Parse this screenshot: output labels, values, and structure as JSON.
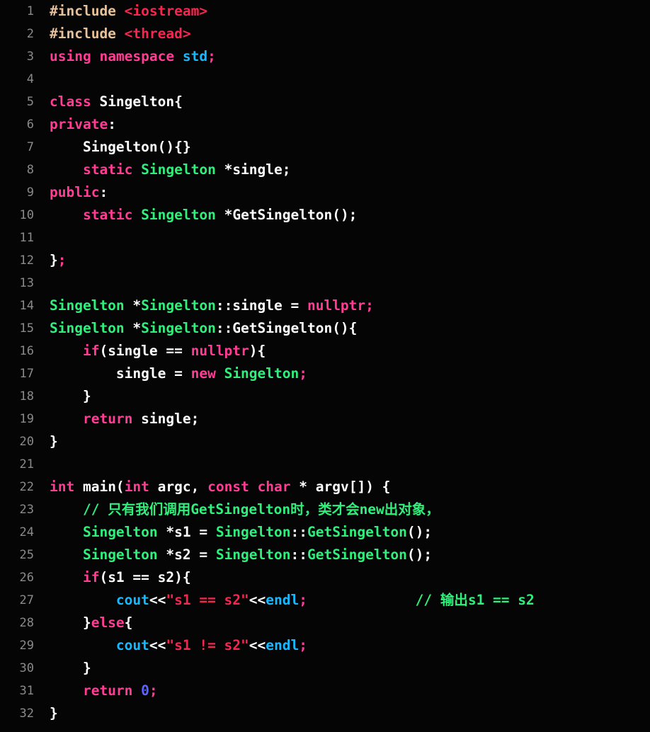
{
  "editor": {
    "language": "cpp",
    "background_color": "#050505",
    "gutter_color": "#8a8a8a",
    "total_lines": 32,
    "colors": {
      "keyword": "#ff3d94",
      "type": "#2ff07a",
      "comment": "#2ff07a",
      "string": "#f5274e",
      "preprocessor": "#e8c09a",
      "header": "#f5274e",
      "builtin": "#18b8ff",
      "number": "#5c63ff",
      "plain": "#ffffff"
    },
    "lines": [
      {
        "number": "1",
        "tokens": [
          {
            "t": "#include",
            "c": "pre"
          },
          {
            "t": " ",
            "c": "plain"
          },
          {
            "t": "<iostream>",
            "c": "header"
          }
        ]
      },
      {
        "number": "2",
        "tokens": [
          {
            "t": "#include",
            "c": "pre"
          },
          {
            "t": " ",
            "c": "plain"
          },
          {
            "t": "<thread>",
            "c": "header"
          }
        ]
      },
      {
        "number": "3",
        "tokens": [
          {
            "t": "using",
            "c": "kw"
          },
          {
            "t": " ",
            "c": "plain"
          },
          {
            "t": "namespace",
            "c": "kw"
          },
          {
            "t": " ",
            "c": "plain"
          },
          {
            "t": "std",
            "c": "builtin"
          },
          {
            "t": ";",
            "c": "semi"
          }
        ]
      },
      {
        "number": "4",
        "tokens": []
      },
      {
        "number": "5",
        "tokens": [
          {
            "t": "class",
            "c": "kw"
          },
          {
            "t": " ",
            "c": "plain"
          },
          {
            "t": "Singelton{",
            "c": "plain"
          }
        ]
      },
      {
        "number": "6",
        "tokens": [
          {
            "t": "private",
            "c": "kw"
          },
          {
            "t": ":",
            "c": "plain"
          }
        ]
      },
      {
        "number": "7",
        "tokens": [
          {
            "t": "    Singelton(){}",
            "c": "plain"
          }
        ]
      },
      {
        "number": "8",
        "tokens": [
          {
            "t": "    ",
            "c": "plain"
          },
          {
            "t": "static",
            "c": "kw"
          },
          {
            "t": " ",
            "c": "plain"
          },
          {
            "t": "Singelton",
            "c": "type"
          },
          {
            "t": " *single;",
            "c": "plain"
          }
        ]
      },
      {
        "number": "9",
        "tokens": [
          {
            "t": "public",
            "c": "kw"
          },
          {
            "t": ":",
            "c": "plain"
          }
        ]
      },
      {
        "number": "10",
        "tokens": [
          {
            "t": "    ",
            "c": "plain"
          },
          {
            "t": "static",
            "c": "kw"
          },
          {
            "t": " ",
            "c": "plain"
          },
          {
            "t": "Singelton",
            "c": "type"
          },
          {
            "t": " *GetSingelton();",
            "c": "plain"
          }
        ]
      },
      {
        "number": "11",
        "tokens": []
      },
      {
        "number": "12",
        "tokens": [
          {
            "t": "}",
            "c": "plain"
          },
          {
            "t": ";",
            "c": "semi"
          }
        ]
      },
      {
        "number": "13",
        "tokens": []
      },
      {
        "number": "14",
        "tokens": [
          {
            "t": "Singelton",
            "c": "type"
          },
          {
            "t": " *",
            "c": "plain"
          },
          {
            "t": "Singelton",
            "c": "type"
          },
          {
            "t": "::single = ",
            "c": "plain"
          },
          {
            "t": "nullptr",
            "c": "kw"
          },
          {
            "t": ";",
            "c": "semi"
          }
        ]
      },
      {
        "number": "15",
        "tokens": [
          {
            "t": "Singelton",
            "c": "type"
          },
          {
            "t": " *",
            "c": "plain"
          },
          {
            "t": "Singelton",
            "c": "type"
          },
          {
            "t": "::GetSingelton(){",
            "c": "plain"
          }
        ]
      },
      {
        "number": "16",
        "tokens": [
          {
            "t": "    ",
            "c": "plain"
          },
          {
            "t": "if",
            "c": "kw"
          },
          {
            "t": "(single == ",
            "c": "plain"
          },
          {
            "t": "nullptr",
            "c": "kw"
          },
          {
            "t": "){",
            "c": "plain"
          }
        ]
      },
      {
        "number": "17",
        "tokens": [
          {
            "t": "        single = ",
            "c": "plain"
          },
          {
            "t": "new",
            "c": "kw"
          },
          {
            "t": " ",
            "c": "plain"
          },
          {
            "t": "Singelton",
            "c": "type"
          },
          {
            "t": ";",
            "c": "semi"
          }
        ]
      },
      {
        "number": "18",
        "tokens": [
          {
            "t": "    }",
            "c": "plain"
          }
        ]
      },
      {
        "number": "19",
        "tokens": [
          {
            "t": "    ",
            "c": "plain"
          },
          {
            "t": "return",
            "c": "kw"
          },
          {
            "t": " single;",
            "c": "plain"
          }
        ]
      },
      {
        "number": "20",
        "tokens": [
          {
            "t": "}",
            "c": "plain"
          }
        ]
      },
      {
        "number": "21",
        "tokens": []
      },
      {
        "number": "22",
        "tokens": [
          {
            "t": "int",
            "c": "kw"
          },
          {
            "t": " main(",
            "c": "plain"
          },
          {
            "t": "int",
            "c": "kw"
          },
          {
            "t": " argc, ",
            "c": "plain"
          },
          {
            "t": "const",
            "c": "kw"
          },
          {
            "t": " ",
            "c": "plain"
          },
          {
            "t": "char",
            "c": "kw"
          },
          {
            "t": " * argv[]) {",
            "c": "plain"
          }
        ]
      },
      {
        "number": "23",
        "tokens": [
          {
            "t": "    ",
            "c": "plain"
          },
          {
            "t": "// 只有我们调用GetSingelton时，类才会new出对象，",
            "c": "comment"
          }
        ]
      },
      {
        "number": "24",
        "tokens": [
          {
            "t": "    ",
            "c": "plain"
          },
          {
            "t": "Singelton",
            "c": "type"
          },
          {
            "t": " *s1 = ",
            "c": "plain"
          },
          {
            "t": "Singelton",
            "c": "type"
          },
          {
            "t": "::",
            "c": "plain"
          },
          {
            "t": "GetSingelton",
            "c": "type"
          },
          {
            "t": "();",
            "c": "plain"
          }
        ]
      },
      {
        "number": "25",
        "tokens": [
          {
            "t": "    ",
            "c": "plain"
          },
          {
            "t": "Singelton",
            "c": "type"
          },
          {
            "t": " *s2 = ",
            "c": "plain"
          },
          {
            "t": "Singelton",
            "c": "type"
          },
          {
            "t": "::",
            "c": "plain"
          },
          {
            "t": "GetSingelton",
            "c": "type"
          },
          {
            "t": "();",
            "c": "plain"
          }
        ]
      },
      {
        "number": "26",
        "tokens": [
          {
            "t": "    ",
            "c": "plain"
          },
          {
            "t": "if",
            "c": "kw"
          },
          {
            "t": "(s1 == s2){",
            "c": "plain"
          }
        ]
      },
      {
        "number": "27",
        "tokens": [
          {
            "t": "        ",
            "c": "plain"
          },
          {
            "t": "cout",
            "c": "builtin"
          },
          {
            "t": "<<",
            "c": "plain"
          },
          {
            "t": "\"s1 == s2\"",
            "c": "string"
          },
          {
            "t": "<<",
            "c": "plain"
          },
          {
            "t": "endl",
            "c": "builtin"
          },
          {
            "t": ";",
            "c": "semi"
          },
          {
            "t": "             ",
            "c": "plain"
          },
          {
            "t": "// 输出s1 == s2",
            "c": "comment"
          }
        ]
      },
      {
        "number": "28",
        "tokens": [
          {
            "t": "    }",
            "c": "plain"
          },
          {
            "t": "else",
            "c": "kw"
          },
          {
            "t": "{",
            "c": "plain"
          }
        ]
      },
      {
        "number": "29",
        "tokens": [
          {
            "t": "        ",
            "c": "plain"
          },
          {
            "t": "cout",
            "c": "builtin"
          },
          {
            "t": "<<",
            "c": "plain"
          },
          {
            "t": "\"s1 != s2\"",
            "c": "string"
          },
          {
            "t": "<<",
            "c": "plain"
          },
          {
            "t": "endl",
            "c": "builtin"
          },
          {
            "t": ";",
            "c": "semi"
          }
        ]
      },
      {
        "number": "30",
        "tokens": [
          {
            "t": "    }",
            "c": "plain"
          }
        ]
      },
      {
        "number": "31",
        "tokens": [
          {
            "t": "    ",
            "c": "plain"
          },
          {
            "t": "return",
            "c": "kw"
          },
          {
            "t": " ",
            "c": "plain"
          },
          {
            "t": "0",
            "c": "number"
          },
          {
            "t": ";",
            "c": "semi"
          }
        ]
      },
      {
        "number": "32",
        "tokens": [
          {
            "t": "}",
            "c": "plain"
          }
        ]
      }
    ]
  }
}
